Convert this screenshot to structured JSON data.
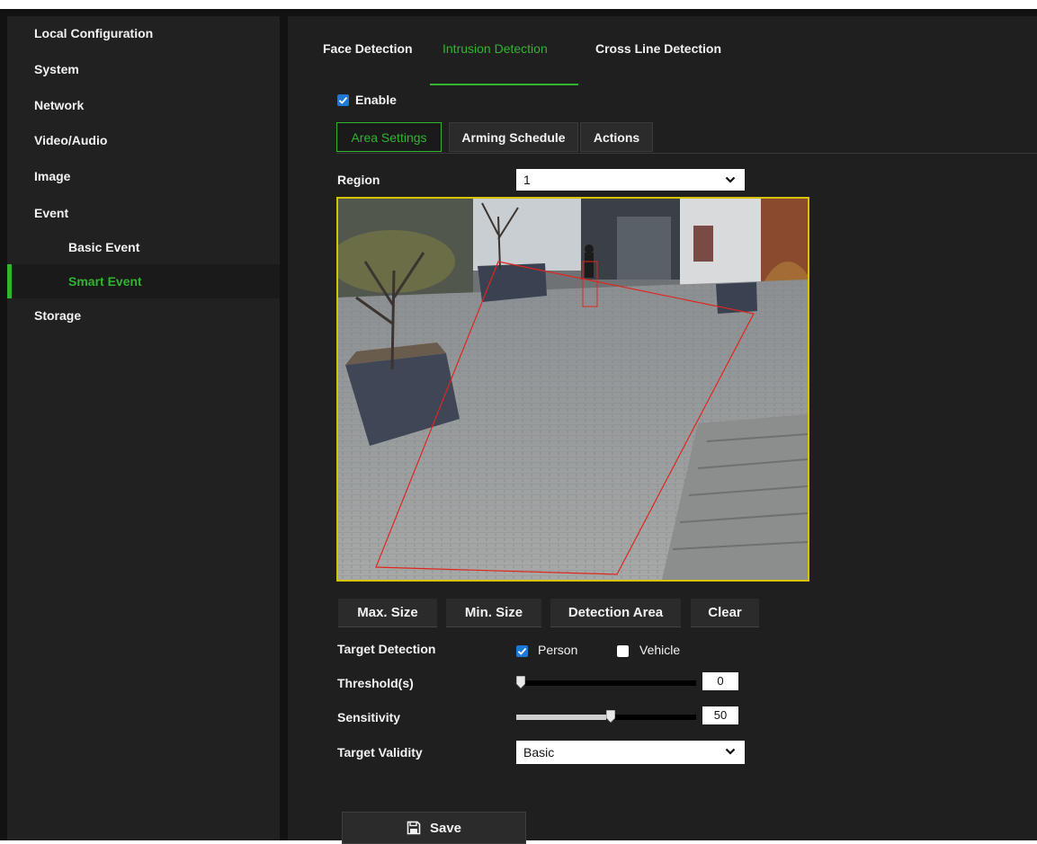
{
  "sidebar": {
    "items": [
      {
        "label": "Local Configuration"
      },
      {
        "label": "System"
      },
      {
        "label": "Network"
      },
      {
        "label": "Video/Audio"
      },
      {
        "label": "Image"
      },
      {
        "label": "Event"
      },
      {
        "label": "Basic Event"
      },
      {
        "label": "Smart Event",
        "active": true
      },
      {
        "label": "Storage"
      }
    ]
  },
  "tabs": [
    {
      "label": "Face Detection"
    },
    {
      "label": "Intrusion Detection",
      "active": true
    },
    {
      "label": "Cross Line Detection"
    }
  ],
  "enable": {
    "label": "Enable",
    "checked": true
  },
  "subtabs": [
    {
      "label": "Area Settings",
      "active": true
    },
    {
      "label": "Arming Schedule"
    },
    {
      "label": "Actions"
    }
  ],
  "region": {
    "label": "Region",
    "value": "1"
  },
  "camera": {
    "icon": "camera-feed-image"
  },
  "buttons": {
    "max_size": "Max. Size",
    "min_size": "Min. Size",
    "detection_area": "Detection Area",
    "clear": "Clear"
  },
  "target_detection": {
    "label": "Target Detection",
    "person": {
      "label": "Person",
      "checked": true
    },
    "vehicle": {
      "label": "Vehicle",
      "checked": false
    }
  },
  "threshold": {
    "label": "Threshold(s)",
    "value": "0",
    "fraction": 0.0
  },
  "sensitivity": {
    "label": "Sensitivity",
    "value": "50",
    "fraction": 0.5
  },
  "target_validity": {
    "label": "Target Validity",
    "value": "Basic"
  },
  "save": {
    "label": "Save",
    "icon": "floppy-disk-icon"
  },
  "colors": {
    "accent": "#2fb52f",
    "checkbox": "#1e78d6",
    "roi": "#e0261e",
    "frame": "#d9c300"
  }
}
